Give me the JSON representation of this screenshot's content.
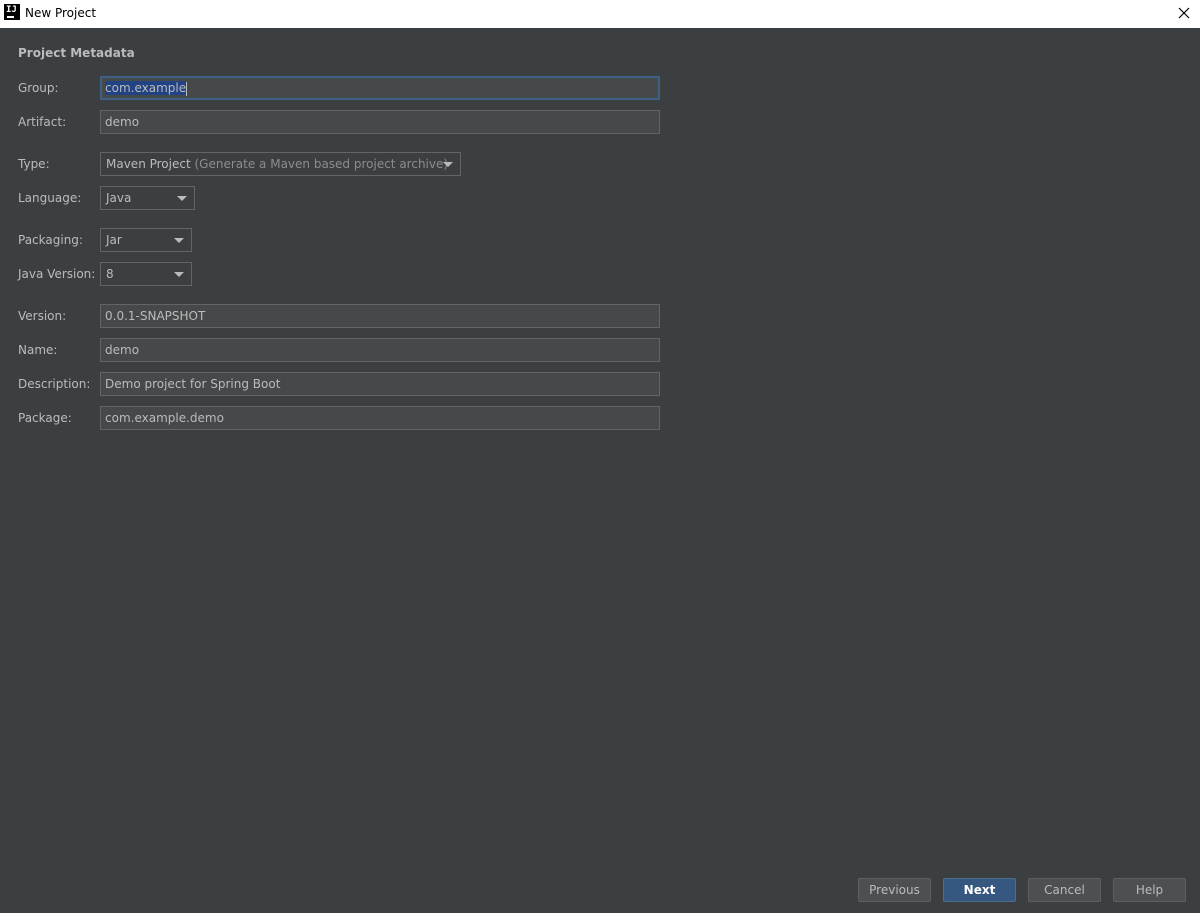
{
  "window": {
    "title": "New Project",
    "app_icon_text": "IJ"
  },
  "section": {
    "title": "Project Metadata"
  },
  "fields": {
    "group": {
      "label": "Group:",
      "value": "com.example"
    },
    "artifact": {
      "label": "Artifact:",
      "value": "demo"
    },
    "type": {
      "label": "Type:",
      "value": "Maven Project",
      "hint": "(Generate a Maven based project archive)"
    },
    "language": {
      "label": "Language:",
      "value": "Java"
    },
    "packaging": {
      "label": "Packaging:",
      "value": "Jar"
    },
    "java_version": {
      "label": "Java Version:",
      "value": "8"
    },
    "version": {
      "label": "Version:",
      "value": "0.0.1-SNAPSHOT"
    },
    "name": {
      "label": "Name:",
      "value": "demo"
    },
    "description": {
      "label": "Description:",
      "value": "Demo project for Spring Boot"
    },
    "package": {
      "label": "Package:",
      "value": "com.example.demo"
    }
  },
  "buttons": {
    "previous": "Previous",
    "next": "Next",
    "cancel": "Cancel",
    "help": "Help"
  },
  "colors": {
    "background": "#3c3f41",
    "field_background": "#45494a",
    "focus_border": "#3d6185",
    "primary_button": "#365880",
    "text": "#bbbbbb"
  }
}
